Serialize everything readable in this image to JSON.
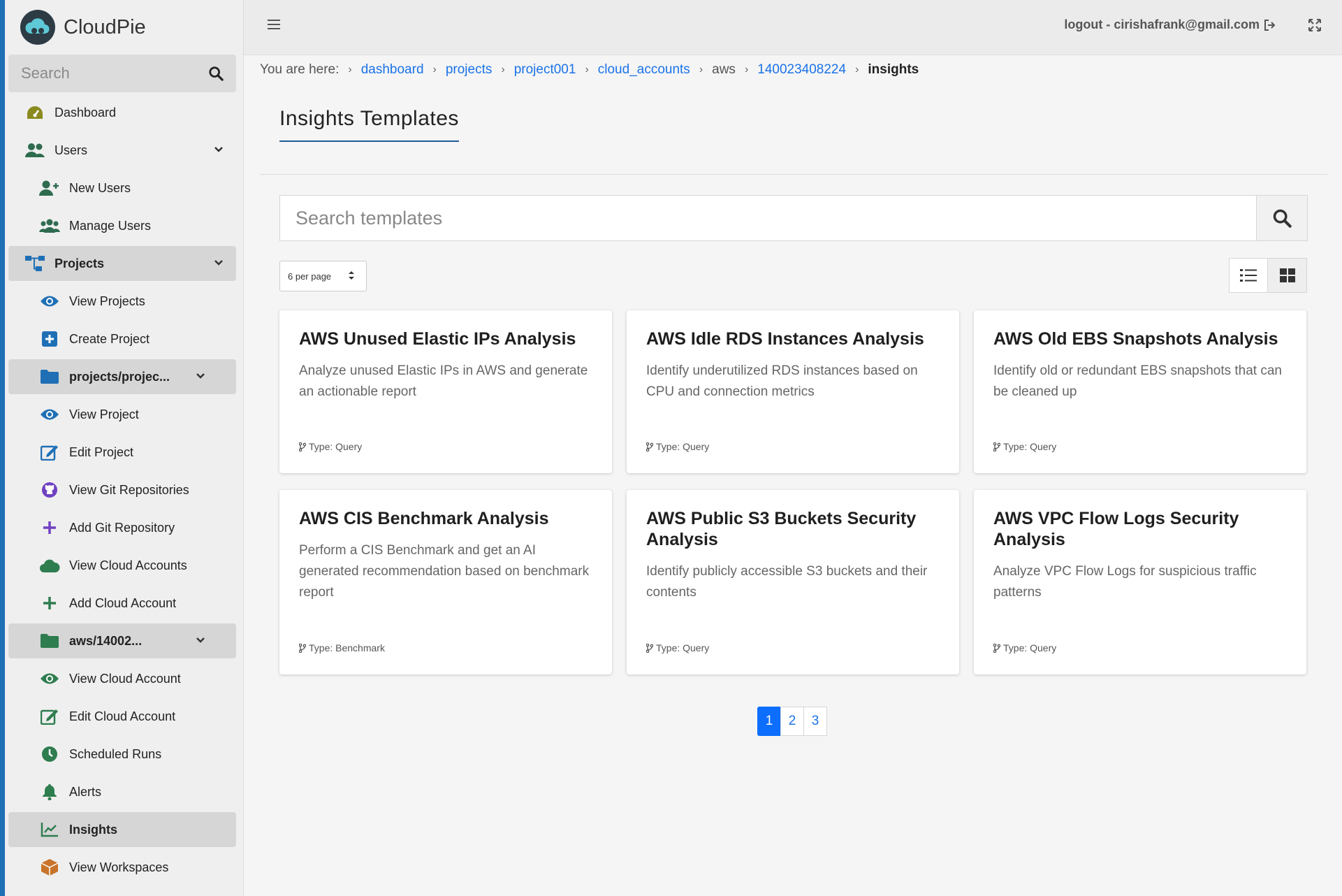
{
  "brand": {
    "name": "CloudPie"
  },
  "sidebar": {
    "search_placeholder": "Search",
    "items": [
      {
        "label": "Dashboard"
      },
      {
        "label": "Users"
      },
      {
        "label": "New Users"
      },
      {
        "label": "Manage Users"
      },
      {
        "label": "Projects"
      },
      {
        "label": "View Projects"
      },
      {
        "label": "Create Project"
      },
      {
        "label": "projects/projec..."
      },
      {
        "label": "View Project"
      },
      {
        "label": "Edit Project"
      },
      {
        "label": "View Git Repositories"
      },
      {
        "label": "Add Git Repository"
      },
      {
        "label": "View Cloud Accounts"
      },
      {
        "label": "Add Cloud Account"
      },
      {
        "label": "aws/14002..."
      },
      {
        "label": "View Cloud Account"
      },
      {
        "label": "Edit Cloud Account"
      },
      {
        "label": "Scheduled Runs"
      },
      {
        "label": "Alerts"
      },
      {
        "label": "Insights"
      },
      {
        "label": "View Workspaces"
      }
    ]
  },
  "topbar": {
    "logout_label": "logout - cirishafrank@gmail.com"
  },
  "breadcrumb": {
    "prefix": "You are here:",
    "items": [
      "dashboard",
      "projects",
      "project001",
      "cloud_accounts",
      "aws",
      "140023408224",
      "insights"
    ]
  },
  "main": {
    "title": "Insights Templates",
    "search_placeholder": "Search templates",
    "per_page": "6 per page",
    "cards": [
      {
        "title": "AWS Unused Elastic IPs Analysis",
        "desc": "Analyze unused Elastic IPs in AWS and generate an actionable report",
        "type": "Type: Query"
      },
      {
        "title": "AWS Idle RDS Instances Analysis",
        "desc": "Identify underutilized RDS instances based on CPU and connection metrics",
        "type": "Type: Query"
      },
      {
        "title": "AWS Old EBS Snapshots Analysis",
        "desc": "Identify old or redundant EBS snapshots that can be cleaned up",
        "type": "Type: Query"
      },
      {
        "title": "AWS CIS Benchmark Analysis",
        "desc": "Perform a CIS Benchmark and get an AI generated recommendation based on benchmark report",
        "type": "Type: Benchmark"
      },
      {
        "title": "AWS Public S3 Buckets Security Analysis",
        "desc": "Identify publicly accessible S3 buckets and their contents",
        "type": "Type: Query"
      },
      {
        "title": "AWS VPC Flow Logs Security Analysis",
        "desc": "Analyze VPC Flow Logs for suspicious traffic patterns",
        "type": "Type: Query"
      }
    ],
    "pagination": [
      "1",
      "2",
      "3"
    ]
  },
  "colors": {
    "accent": "#1a73e8",
    "active_page": "#0d6efd",
    "icon_green": "#2e7d4f",
    "sidebar_stripe": "#1f6fb5"
  }
}
